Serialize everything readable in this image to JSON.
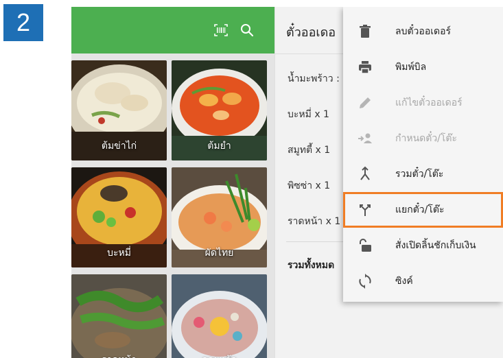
{
  "step_number": "2",
  "header": {
    "barcode_icon": "barcode-scan-icon",
    "search_icon": "search-icon"
  },
  "menu_items": [
    {
      "name": "delete-order-item",
      "label": "ลบตั๋วออเดอร์",
      "icon": "trash-icon",
      "enabled": true
    },
    {
      "name": "print-bill-item",
      "label": "พิมพ์บิล",
      "icon": "printer-icon",
      "enabled": true
    },
    {
      "name": "edit-order-item",
      "label": "แก้ไขตั๋วออเดอร์",
      "icon": "pencil-icon",
      "enabled": false
    },
    {
      "name": "assign-ticket-table-item",
      "label": "กำหนดตั๋ว/โต๊ะ",
      "icon": "assign-person-icon",
      "enabled": false
    },
    {
      "name": "merge-ticket-table-item",
      "label": "รวมตั๋ว/โต๊ะ",
      "icon": "merge-icon",
      "enabled": true
    },
    {
      "name": "split-ticket-table-item",
      "label": "แยกตั๋ว/โต๊ะ",
      "icon": "split-icon",
      "enabled": true,
      "highlighted": true
    },
    {
      "name": "open-cash-drawer-item",
      "label": "สั่งเปิดลิ้นชักเก็บเงิน",
      "icon": "unlock-icon",
      "enabled": true
    },
    {
      "name": "sync-item",
      "label": "ซิงค์",
      "icon": "sync-icon",
      "enabled": true
    }
  ],
  "products": [
    {
      "name": "ต้มข่าไก่"
    },
    {
      "name": "ต้มยำ"
    },
    {
      "name": "บะหมี่"
    },
    {
      "name": "ผัดไทย"
    },
    {
      "name": "ราดหน้า"
    },
    {
      "name": "ลอยแก้ว"
    }
  ],
  "order": {
    "title": "ตั๋วออเดอ",
    "lines": [
      "น้ำมะพร้าว :",
      "บะหมี่ x 1",
      "สมูทตี้ x 1",
      "พิซซ่า x 1",
      "ราดหน้า x 1"
    ],
    "total_label": "รวมทั้งหมด"
  }
}
